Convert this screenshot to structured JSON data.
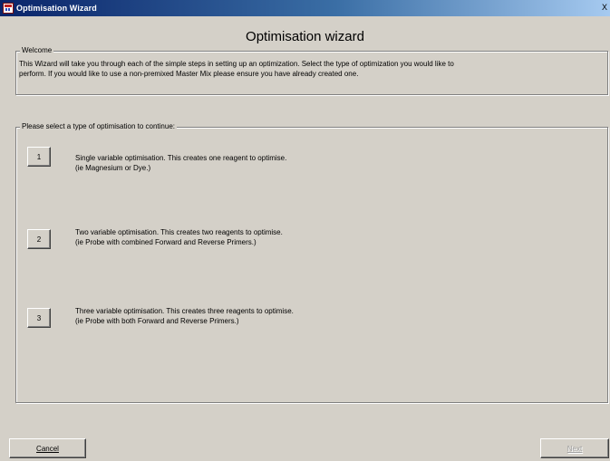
{
  "window": {
    "title": "Optimisation Wizard",
    "close_label": "X"
  },
  "heading": "Optimisation wizard",
  "welcome": {
    "legend": "Welcome",
    "line1": "This Wizard will take you through each of the simple steps in setting up an optimization. Select the type of optimization you would like to",
    "line2": "perform.  If you would like to use a non-premixed Master Mix please ensure you have already created one."
  },
  "selection": {
    "legend": "Please select a type of optimisation to continue:",
    "options": [
      {
        "button_label": "1",
        "line1": "Single variable optimisation. This creates one reagent to optimise.",
        "line2": "(ie Magnesium or Dye.)"
      },
      {
        "button_label": "2",
        "line1": "Two variable optimisation. This creates two reagents to optimise.",
        "line2": "(ie Probe with combined Forward and Reverse Primers.)"
      },
      {
        "button_label": "3",
        "line1": "Three variable optimisation. This creates three reagents to optimise.",
        "line2": "(ie Probe with both Forward and Reverse Primers.)"
      }
    ]
  },
  "buttons": {
    "cancel": "Cancel",
    "next": "Next"
  },
  "colors": {
    "face": "#d4d0c8",
    "titlebar_start": "#0a246a",
    "titlebar_end": "#a6caf0"
  }
}
